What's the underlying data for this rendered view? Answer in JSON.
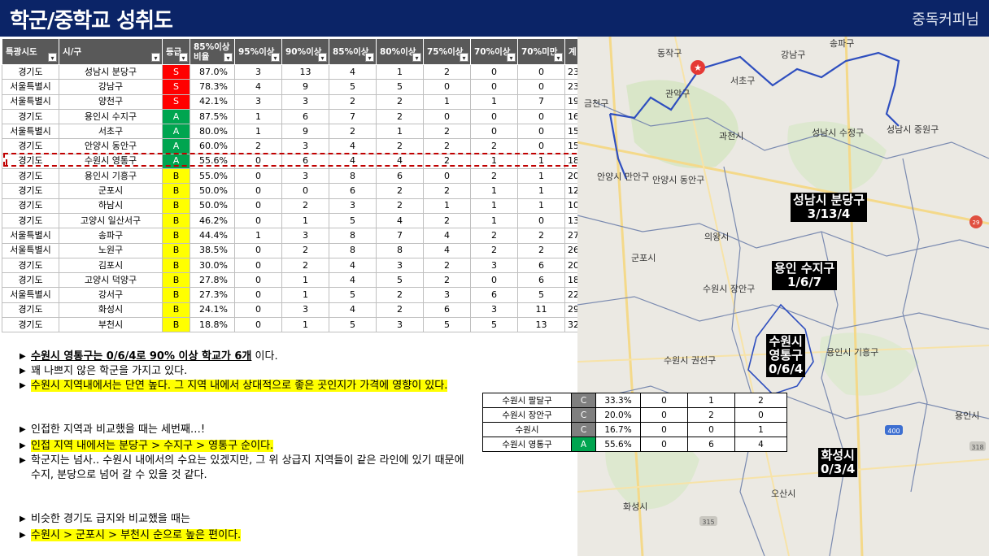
{
  "header": {
    "title": "학군/중학교 성취도",
    "brand": "중독커피님"
  },
  "table": {
    "headers": [
      "특광시도",
      "시/구",
      "등급",
      "85%이상 비율",
      "95%이상",
      "90%이상",
      "85%이상",
      "80%이상",
      "75%이상",
      "70%이상",
      "70%미만",
      "계"
    ],
    "rows": [
      [
        "경기도",
        "성남시 분당구",
        "S",
        "87.0%",
        "3",
        "13",
        "4",
        "1",
        "2",
        "0",
        "0",
        "23"
      ],
      [
        "서울특별시",
        "강남구",
        "S",
        "78.3%",
        "4",
        "9",
        "5",
        "5",
        "0",
        "0",
        "0",
        "23"
      ],
      [
        "서울특별시",
        "양천구",
        "S",
        "42.1%",
        "3",
        "3",
        "2",
        "2",
        "1",
        "1",
        "7",
        "19"
      ],
      [
        "경기도",
        "용인시 수지구",
        "A",
        "87.5%",
        "1",
        "6",
        "7",
        "2",
        "0",
        "0",
        "0",
        "16"
      ],
      [
        "서울특별시",
        "서초구",
        "A",
        "80.0%",
        "1",
        "9",
        "2",
        "1",
        "2",
        "0",
        "0",
        "15"
      ],
      [
        "경기도",
        "안양시 동안구",
        "A",
        "60.0%",
        "2",
        "3",
        "4",
        "2",
        "2",
        "2",
        "0",
        "15"
      ],
      [
        "경기도",
        "수원시 영통구",
        "A",
        "55.6%",
        "0",
        "6",
        "4",
        "4",
        "2",
        "1",
        "1",
        "18"
      ],
      [
        "경기도",
        "용인시 기흥구",
        "B",
        "55.0%",
        "0",
        "3",
        "8",
        "6",
        "0",
        "2",
        "1",
        "20"
      ],
      [
        "경기도",
        "군포시",
        "B",
        "50.0%",
        "0",
        "0",
        "6",
        "2",
        "2",
        "1",
        "1",
        "12"
      ],
      [
        "경기도",
        "하남시",
        "B",
        "50.0%",
        "0",
        "2",
        "3",
        "2",
        "1",
        "1",
        "1",
        "10"
      ],
      [
        "경기도",
        "고양시 일산서구",
        "B",
        "46.2%",
        "0",
        "1",
        "5",
        "4",
        "2",
        "1",
        "0",
        "13"
      ],
      [
        "서울특별시",
        "송파구",
        "B",
        "44.4%",
        "1",
        "3",
        "8",
        "7",
        "4",
        "2",
        "2",
        "27"
      ],
      [
        "서울특별시",
        "노원구",
        "B",
        "38.5%",
        "0",
        "2",
        "8",
        "8",
        "4",
        "2",
        "2",
        "26"
      ],
      [
        "경기도",
        "김포시",
        "B",
        "30.0%",
        "0",
        "2",
        "4",
        "3",
        "2",
        "3",
        "6",
        "20"
      ],
      [
        "경기도",
        "고양시 덕양구",
        "B",
        "27.8%",
        "0",
        "1",
        "4",
        "5",
        "2",
        "0",
        "6",
        "18"
      ],
      [
        "서울특별시",
        "강서구",
        "B",
        "27.3%",
        "0",
        "1",
        "5",
        "2",
        "3",
        "6",
        "5",
        "22"
      ],
      [
        "경기도",
        "화성시",
        "B",
        "24.1%",
        "0",
        "3",
        "4",
        "2",
        "6",
        "3",
        "11",
        "29"
      ],
      [
        "경기도",
        "부천시",
        "B",
        "18.8%",
        "0",
        "1",
        "5",
        "3",
        "5",
        "5",
        "13",
        "32"
      ]
    ]
  },
  "notes": [
    {
      "parts": [
        {
          "t": "수원시 영통구는 0/6/4로 90% 이상 학교가 6개",
          "style": "bu"
        },
        {
          "t": " 이다.",
          "style": ""
        }
      ]
    },
    {
      "parts": [
        {
          "t": "꽤 나쁘지 않은 학군을 가지고 있다.",
          "style": ""
        }
      ]
    },
    {
      "parts": [
        {
          "t": "수원시 지역내에서는 단연 높다. 그 지역 내에서 상대적으로 좋은 곳인지가 가격에 영향이 있다.",
          "style": "hl"
        }
      ]
    },
    {
      "parts": [
        {
          "t": "인접한 지역과 비교했을 때는 세번째…!",
          "style": ""
        }
      ]
    },
    {
      "parts": [
        {
          "t": "인접 지역 내에서는 분당구 > 수지구 > 영통구 순이다.",
          "style": "hl"
        }
      ]
    },
    {
      "parts": [
        {
          "t": "학군지는 넘사.. 수원시 내에서의 수요는 있겠지만, 그 위 상급지 지역들이 같은 라인에 있기 때문에 수지, 분당으로 넘어 갈 수 있을 것 같다.",
          "style": ""
        }
      ]
    },
    {
      "parts": [
        {
          "t": "비슷한 경기도 급지와 비교했을 때는",
          "style": ""
        }
      ]
    },
    {
      "parts": [
        {
          "t": "수원시 > 군포시 > 부천시 순으로 높은 편이다.",
          "style": "hl"
        }
      ]
    }
  ],
  "small_table": {
    "rows": [
      [
        "수원시 팔달구",
        "C",
        "33.3%",
        "0",
        "1",
        "2"
      ],
      [
        "수원시 장안구",
        "C",
        "20.0%",
        "0",
        "2",
        "0"
      ],
      [
        "수원시",
        "C",
        "16.7%",
        "0",
        "0",
        "1"
      ],
      [
        "수원시 영통구",
        "A",
        "55.6%",
        "0",
        "6",
        "4"
      ]
    ]
  },
  "map": {
    "labels": [
      "동작구",
      "강남구",
      "송파구",
      "서초구",
      "관악구",
      "금천구",
      "과천시",
      "성남시 수정구",
      "성남시 중원구",
      "안양시 만안구",
      "안양시 동안구",
      "의왕시",
      "군포시",
      "수원시 장안구",
      "수원시 권선구",
      "용인시 기흥구",
      "오산시",
      "화성시",
      "용인시"
    ],
    "callouts": [
      {
        "name": "성남시 분당구",
        "value": "3/13/4"
      },
      {
        "name": "용인 수지구",
        "value": "1/6/7"
      },
      {
        "name": "수원시 영통구",
        "value": "0/6/4",
        "lines": [
          "수원시",
          "영통구",
          "0/6/4"
        ]
      },
      {
        "name": "화성시",
        "value": "0/3/4"
      }
    ]
  },
  "colors": {
    "header_bg": "#0b2467",
    "grade_S": "#ff0000",
    "grade_A": "#00a550",
    "grade_B": "#ffff00",
    "grade_C": "#7f7f7f",
    "highlight": "#ffff00"
  }
}
